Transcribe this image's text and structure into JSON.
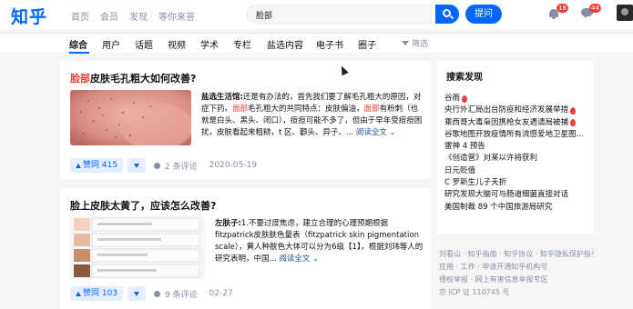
{
  "header": {
    "logo": "知乎",
    "nav": [
      "首页",
      "会员",
      "发现",
      "等你来答"
    ],
    "search_value": "脸部",
    "ask_label": "提问",
    "notification_badge": "18",
    "message_badge": "44"
  },
  "tabs": [
    "综合",
    "用户",
    "话题",
    "视频",
    "学术",
    "专栏",
    "盐选内容",
    "电子书",
    "圈子"
  ],
  "filter_label": "筛选",
  "results": [
    {
      "title_hl": "脸部",
      "title_rest": "皮肤毛孔粗大如何改善?",
      "author": "盐选生活馆:",
      "excerpt_1": "还是有办法的，首先我们要了解毛孔粗大的原因，对症下药。",
      "excerpt_hl1": "面部",
      "excerpt_2": "毛孔粗大的共同特点：皮肤偏油，",
      "excerpt_hl2": "面部",
      "excerpt_3": "有粉刺（也就是白头、黑头、闭口），痘痘可能不多了，但由于早年受痘痘困扰，皮肤看起来粗糙，t 区、颧头、异子、...",
      "more_label": "阅读全文",
      "upvote_label": "赞同 415",
      "comments_label": "2 条评论",
      "date": "2020-05-19"
    },
    {
      "title": "脸上皮肤太黄了，应该怎么改善?",
      "author": "左肤子:",
      "excerpt": "1.不要过度焦虑，建立合理的心理预期根据fitzpatrick皮肤肤色量表（fitzpatrick skin pigmentation scale），黄人种肤色大体可以分为6级【1】，根据刘玮等人的研究表明，中国...",
      "more_label": "阅读全文",
      "upvote_label": "赞同 103",
      "comments_label": "9 条评论",
      "date": "02-27"
    }
  ],
  "sidebar": {
    "title": "搜索发现",
    "items": [
      {
        "text": "谷雨",
        "hot": true
      },
      {
        "text": "央行外汇局出台防疫和经济发展举措",
        "hot": true
      },
      {
        "text": "乘西哥大毒枭因携枪女友遇请局被捕",
        "hot": true
      },
      {
        "text": "谷歌地图开放疫情所有流感爱地卫星图...",
        "hot": false
      },
      {
        "text": "雷神 4 预告",
        "hot": false
      },
      {
        "text": "《创造营》对某以许将获利",
        "hot": false
      },
      {
        "text": "日元贬值",
        "hot": false
      },
      {
        "text": "C 罗新生儿子夭折",
        "hot": false
      },
      {
        "text": "研究发现大脑可与肠道细菌直接对话",
        "hot": false
      },
      {
        "text": "美国制裁 89 个中国旅游局研究",
        "hot": false
      }
    ]
  },
  "footer_lines": [
    "刘看山 · 知乎指南 · 知乎协议 · 知乎隐私保护指引",
    "应用 · 工作 · 申请开通知乎机构号",
    "侵权举报 · 网上有害信息举报专区",
    "京 ICP 证 110745 号"
  ],
  "colors": {
    "brand": "#0066ff",
    "highlight": "#f1403c",
    "muted": "#8590a6"
  }
}
